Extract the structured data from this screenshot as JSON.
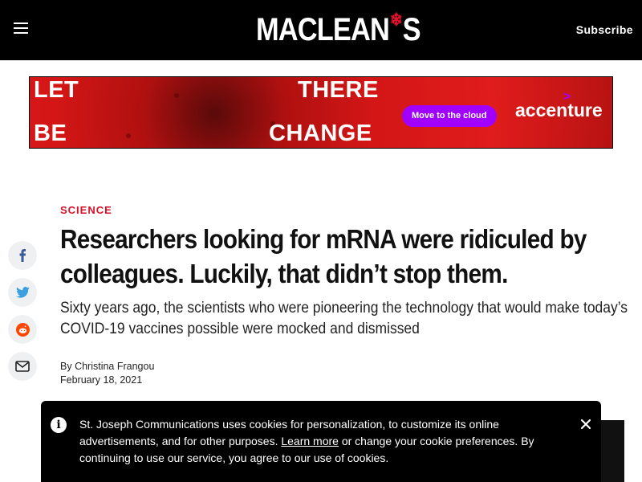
{
  "header": {
    "logo_text_1": "MACLEAN",
    "logo_text_2": "S",
    "subscribe_label": "Subscribe"
  },
  "ad": {
    "words": [
      "LET",
      "THERE",
      "BE",
      "CHANGE"
    ],
    "cta_label": "Move to the cloud",
    "brand": "accenture",
    "colors": {
      "background": "#d41616",
      "cta": "#a100ff"
    }
  },
  "social": {
    "icons": [
      "facebook-icon",
      "twitter-icon",
      "reddit-icon",
      "email-icon"
    ]
  },
  "article": {
    "section": "SCIENCE",
    "headline": "Researchers looking for mRNA were ridiculed by colleagues. Luckily, that didn’t stop them.",
    "dek": "Sixty years ago, the scientists who were pioneering the technology that would make today’s COVID-19 vaccines possible were mocked and dismissed",
    "byline_prefix": "By ",
    "author": "Christina Frangou",
    "date": "February 18, 2021"
  },
  "cookie": {
    "text_before": "St. Joseph Communications uses cookies for personalization, to customize its online advertisements, and for other purposes. ",
    "link": "Learn more",
    "text_after": " or change your cookie preferences. By continuing to use our service, you agree to our use of cookies."
  },
  "colors": {
    "accent": "#d8102a",
    "header_bg": "#000000"
  }
}
